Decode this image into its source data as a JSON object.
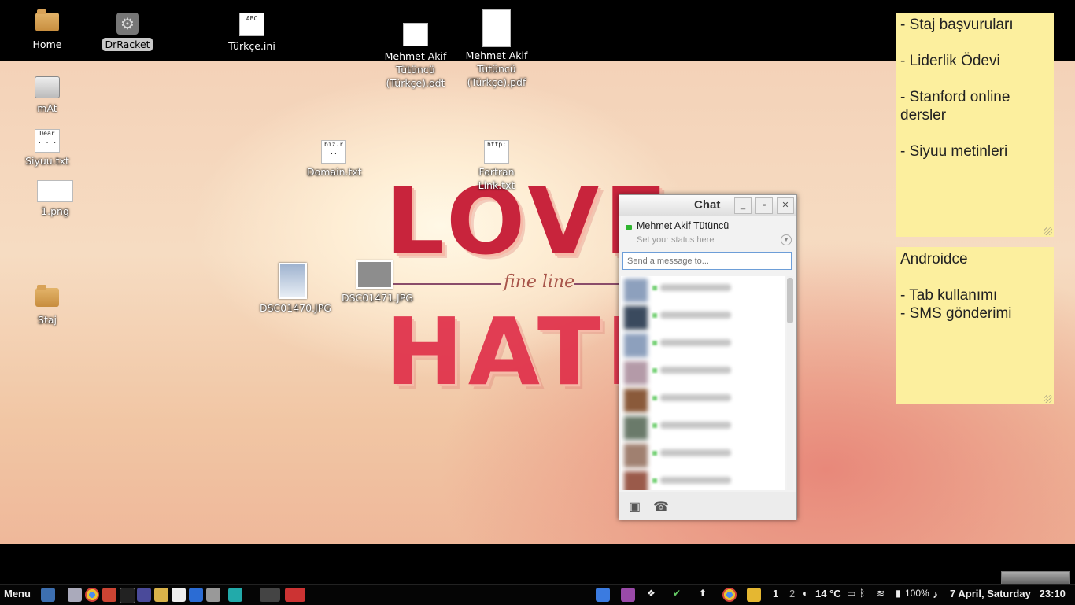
{
  "desktop_icons": {
    "home": "Home",
    "drracket": "DrRacket",
    "turkce_ini": "Türkçe.ini",
    "turkce_ini_thumb": "ABC",
    "odt": [
      "Mehmet Akif",
      "Tütüncü",
      "(Türkçe).odt"
    ],
    "pdf": [
      "Mehmet Akif",
      "Tütüncü",
      "(Türkçe).pdf"
    ],
    "mat": "mAt",
    "siyuu": "Siyuu.txt",
    "siyuu_thumb": "Dear\n. . .",
    "png": "1.png",
    "domain": "Domain.txt",
    "domain_thumb": "biz.r\n..",
    "fortran": "Fortran Link.txt",
    "fortran_thumb": "http:",
    "dsc1": "DSC01470.JPG",
    "dsc2": "DSC01471.JPG",
    "staj": "Staj"
  },
  "wallpaper": {
    "word1": "LOVE",
    "word2": "HATE",
    "middle": "fine line"
  },
  "notes": [
    {
      "lines": [
        "- Staj başvuruları",
        "",
        "- Liderlik Ödevi",
        "",
        "- Stanford online",
        "dersler",
        "",
        "- Siyuu metinleri"
      ]
    },
    {
      "lines": [
        "Androidce",
        "",
        "- Tab kullanımı",
        "- SMS gönderimi"
      ]
    }
  ],
  "chat": {
    "title": "Chat",
    "user_name": "Mehmet Akif Tütüncü",
    "status_placeholder": "Set your status here",
    "message_placeholder": "Send a message to...",
    "contact_count_visible": 8
  },
  "taskbar": {
    "menu": "Menu",
    "workspace_1": "1",
    "workspace_2": "2",
    "temperature": "14 °C",
    "volume": "100%",
    "clock": "7 April, Saturday   23:10"
  },
  "colors": {
    "note_bg": "#fcef9e",
    "chat_online": "#2fb52f",
    "wallpaper_word": "#d2344a"
  }
}
